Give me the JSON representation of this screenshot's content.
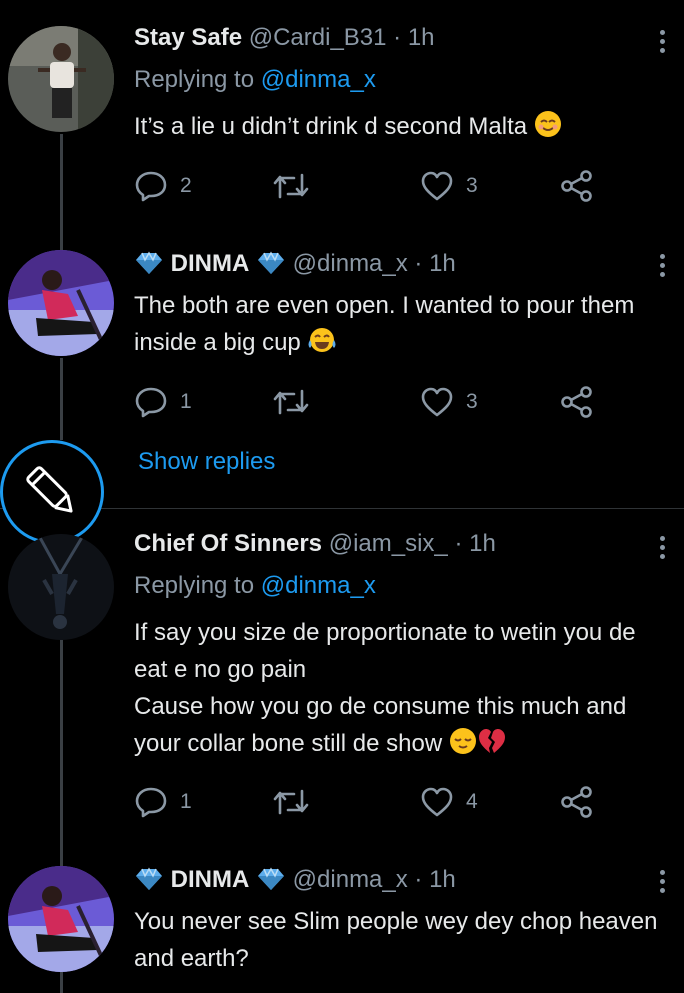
{
  "tweets": [
    {
      "name": "Stay Safe",
      "handle": "@Cardi_B31",
      "time": "· 1h",
      "replying_prefix": "Replying to",
      "replying_to": "@dinma_x",
      "text": "It’s a lie u didn’t drink d second Malta",
      "replies": "2",
      "retweets": "",
      "likes": "3",
      "avatar": "woman-standing-avatar"
    },
    {
      "name": "DINMA",
      "handle": "@dinma_x",
      "time": "· 1h",
      "text": "The both are even open. I wanted to pour them inside a big cup",
      "replies": "1",
      "retweets": "",
      "likes": "3",
      "avatar": "woman-sitting-avatar"
    },
    {
      "name": "Chief Of Sinners",
      "handle": "@iam_six_",
      "time": "· 1h",
      "replying_prefix": "Replying to",
      "replying_to": "@dinma_x",
      "text": "If say you size de proportionate to wetin you de eat e no go pain\nCause how you go de consume this much and your collar bone still de show",
      "replies": "1",
      "retweets": "",
      "likes": "4",
      "avatar": "hanging-figure-avatar"
    },
    {
      "name": "DINMA",
      "handle": "@dinma_x",
      "time": "· 1h",
      "text": "You never see Slim people wey dey chop heaven and earth?",
      "avatar": "woman-sitting-avatar"
    }
  ],
  "show_replies": "Show replies",
  "compose_icon": "pencil-icon",
  "colors": {
    "accent": "#1d9bf0",
    "muted": "#8b98a5",
    "background": "#000000"
  }
}
